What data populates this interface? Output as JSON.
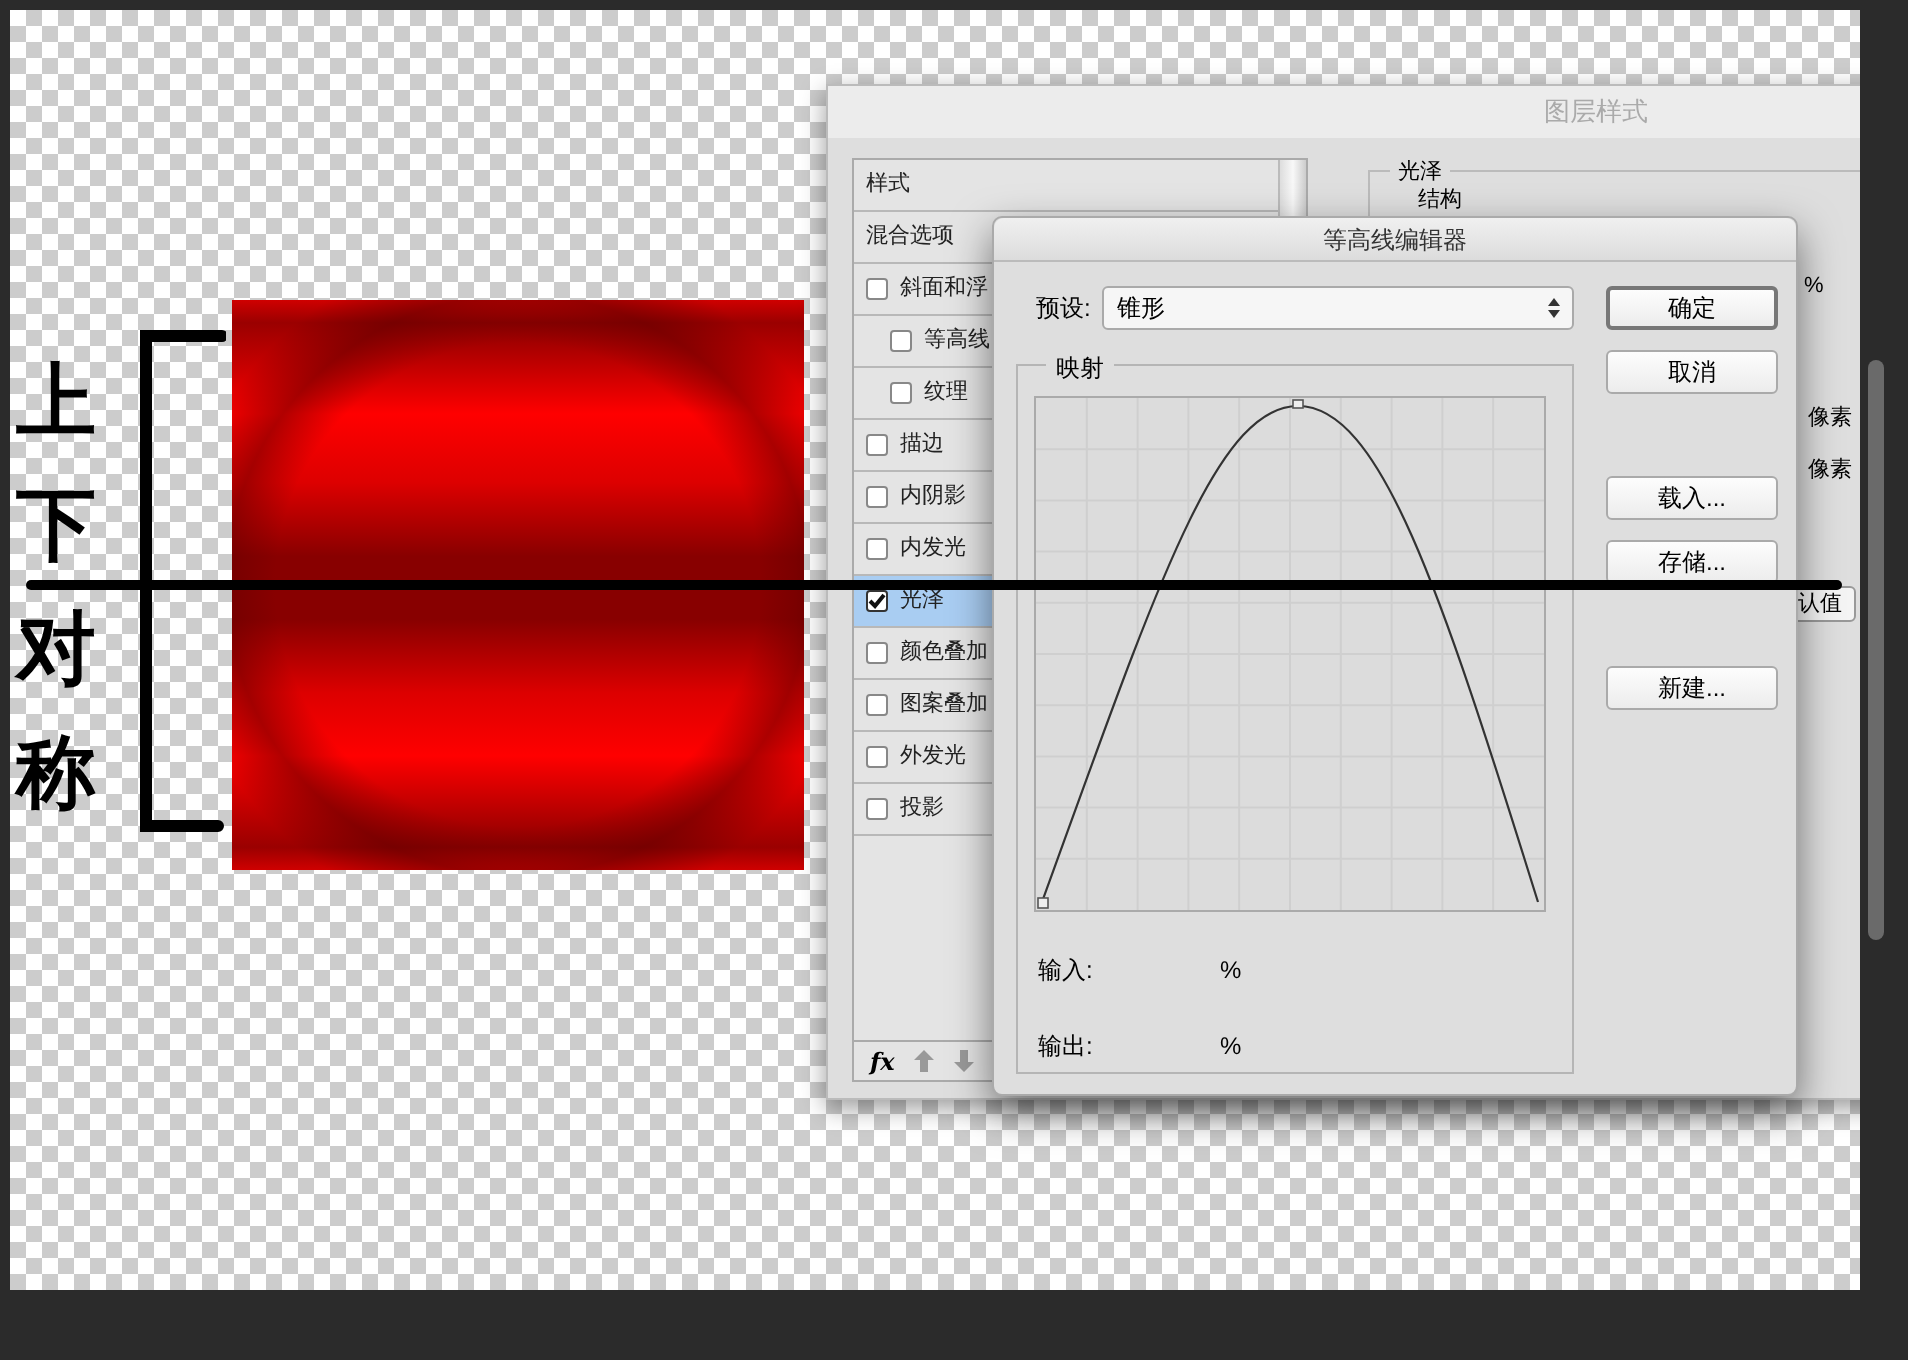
{
  "annotation": {
    "label": "上下对称"
  },
  "layer_style": {
    "title": "图层样式",
    "items": [
      {
        "label": "样式",
        "kind": "header",
        "selected": false
      },
      {
        "label": "混合选项",
        "kind": "header",
        "selected": false
      },
      {
        "label": "斜面和浮",
        "kind": "check",
        "checked": false,
        "selected": false,
        "children": [
          {
            "label": "等高线",
            "kind": "check",
            "checked": false,
            "selected": false
          },
          {
            "label": "纹理",
            "kind": "check",
            "checked": false,
            "selected": false
          }
        ]
      },
      {
        "label": "描边",
        "kind": "check",
        "checked": false,
        "selected": false
      },
      {
        "label": "内阴影",
        "kind": "check",
        "checked": false,
        "selected": false
      },
      {
        "label": "内发光",
        "kind": "check",
        "checked": false,
        "selected": false
      },
      {
        "label": "光泽",
        "kind": "check",
        "checked": true,
        "selected": true
      },
      {
        "label": "颜色叠加",
        "kind": "check",
        "checked": false,
        "selected": false
      },
      {
        "label": "图案叠加",
        "kind": "check",
        "checked": false,
        "selected": false
      },
      {
        "label": "外发光",
        "kind": "check",
        "checked": false,
        "selected": false
      },
      {
        "label": "投影",
        "kind": "check",
        "checked": false,
        "selected": false
      }
    ],
    "fx_label": "fx",
    "section": "光泽",
    "subsection": "结构",
    "units": [
      "%",
      "像素",
      "像素"
    ],
    "reset_button": "认值"
  },
  "contour_editor": {
    "title": "等高线编辑器",
    "preset_label": "预设:",
    "preset": "锥形",
    "group": "映射",
    "input_label": "输入:",
    "input_unit": "%",
    "output_label": "输出:",
    "output_unit": "%",
    "button_groups": [
      [
        {
          "label": "确定",
          "primary": true
        },
        {
          "label": "取消",
          "primary": false
        }
      ],
      [
        {
          "label": "载入...",
          "primary": false
        },
        {
          "label": "存储...",
          "primary": false
        }
      ],
      [
        {
          "label": "新建...",
          "primary": false
        }
      ]
    ]
  }
}
